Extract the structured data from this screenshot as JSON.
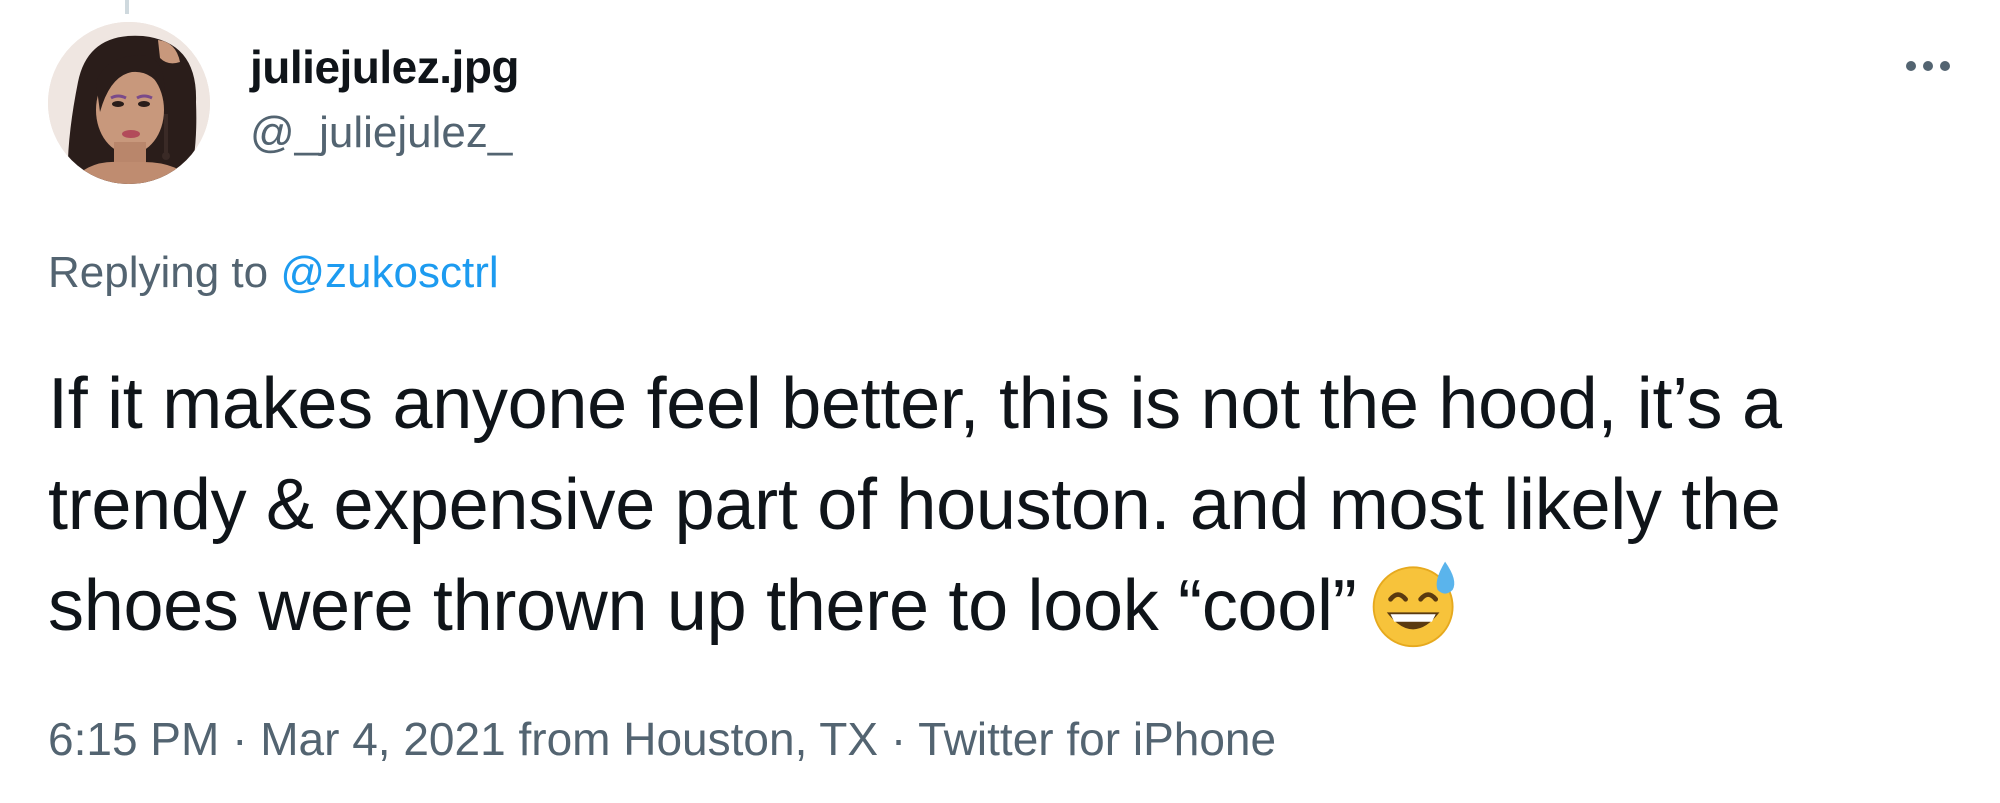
{
  "user": {
    "display_name": "juliejulez.jpg",
    "handle": "@_juliejulez_"
  },
  "reply": {
    "prefix": "Replying to",
    "mention": "@zukosctrl"
  },
  "tweet": {
    "lines": [
      "If it makes anyone feel better, this is not the hood, it’s a",
      "trendy & expensive part of houston. and most likely the",
      "shoes were thrown up there to look “cool”"
    ],
    "emoji": "grinning-face-with-sweat"
  },
  "meta": {
    "time": "6:15 PM",
    "sep1": " · ",
    "date": "Mar 4, 2021",
    "location": " from Houston, TX",
    "sep2": " · ",
    "source": "Twitter for iPhone"
  },
  "icons": {
    "more": "more-horizontal-icon"
  },
  "colors": {
    "text": "#0f1419",
    "secondary": "#536471",
    "link": "#1d9bf0"
  }
}
